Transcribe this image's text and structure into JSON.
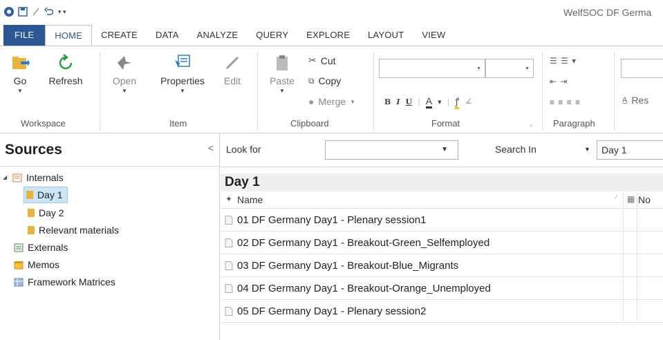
{
  "window": {
    "title": "WelfSOC DF Germa"
  },
  "qat": {
    "save_icon": "floppy-icon",
    "undo_icon": "undo-icon",
    "customize_glyph": "▾ ▾"
  },
  "tabs": [
    {
      "label": "FILE"
    },
    {
      "label": "HOME"
    },
    {
      "label": "CREATE"
    },
    {
      "label": "DATA"
    },
    {
      "label": "ANALYZE"
    },
    {
      "label": "QUERY"
    },
    {
      "label": "EXPLORE"
    },
    {
      "label": "LAYOUT"
    },
    {
      "label": "VIEW"
    }
  ],
  "ribbon": {
    "workspace": {
      "label": "Workspace",
      "go": "Go",
      "refresh": "Refresh"
    },
    "item": {
      "label": "Item",
      "open": "Open",
      "properties": "Properties",
      "edit": "Edit"
    },
    "clipboard": {
      "label": "Clipboard",
      "paste": "Paste",
      "cut": "Cut",
      "copy": "Copy",
      "merge": "Merge"
    },
    "format": {
      "label": "Format",
      "bold": "B",
      "italic": "I",
      "underline": "U",
      "font_color": "A"
    },
    "paragraph": {
      "label": "Paragraph"
    },
    "styles": {
      "reset": "Res"
    }
  },
  "sources": {
    "title": "Sources",
    "collapse_glyph": "<",
    "tree": [
      {
        "label": "Internals"
      },
      {
        "label": "Day 1"
      },
      {
        "label": "Day 2"
      },
      {
        "label": "Relevant materials"
      },
      {
        "label": "Externals"
      },
      {
        "label": "Memos"
      },
      {
        "label": "Framework Matrices"
      }
    ]
  },
  "search": {
    "look_for_label": "Look for",
    "look_for_value": "",
    "search_in_label": "Search In",
    "search_in_value": "Day 1"
  },
  "list": {
    "title": "Day 1",
    "columns": [
      "Name",
      "No"
    ],
    "rows": [
      {
        "name": "01 DF Germany Day1 - Plenary session1"
      },
      {
        "name": "02 DF Germany Day1 - Breakout-Green_Selfemployed"
      },
      {
        "name": "03 DF Germany Day1 - Breakout-Blue_Migrants"
      },
      {
        "name": "04 DF Germany Day1 - Breakout-Orange_Unemployed"
      },
      {
        "name": "05 DF Germany Day1 - Plenary session2"
      }
    ]
  },
  "colors": {
    "accent": "#2b5797",
    "selection": "#cde6f7",
    "folder": "#e8b23c"
  }
}
